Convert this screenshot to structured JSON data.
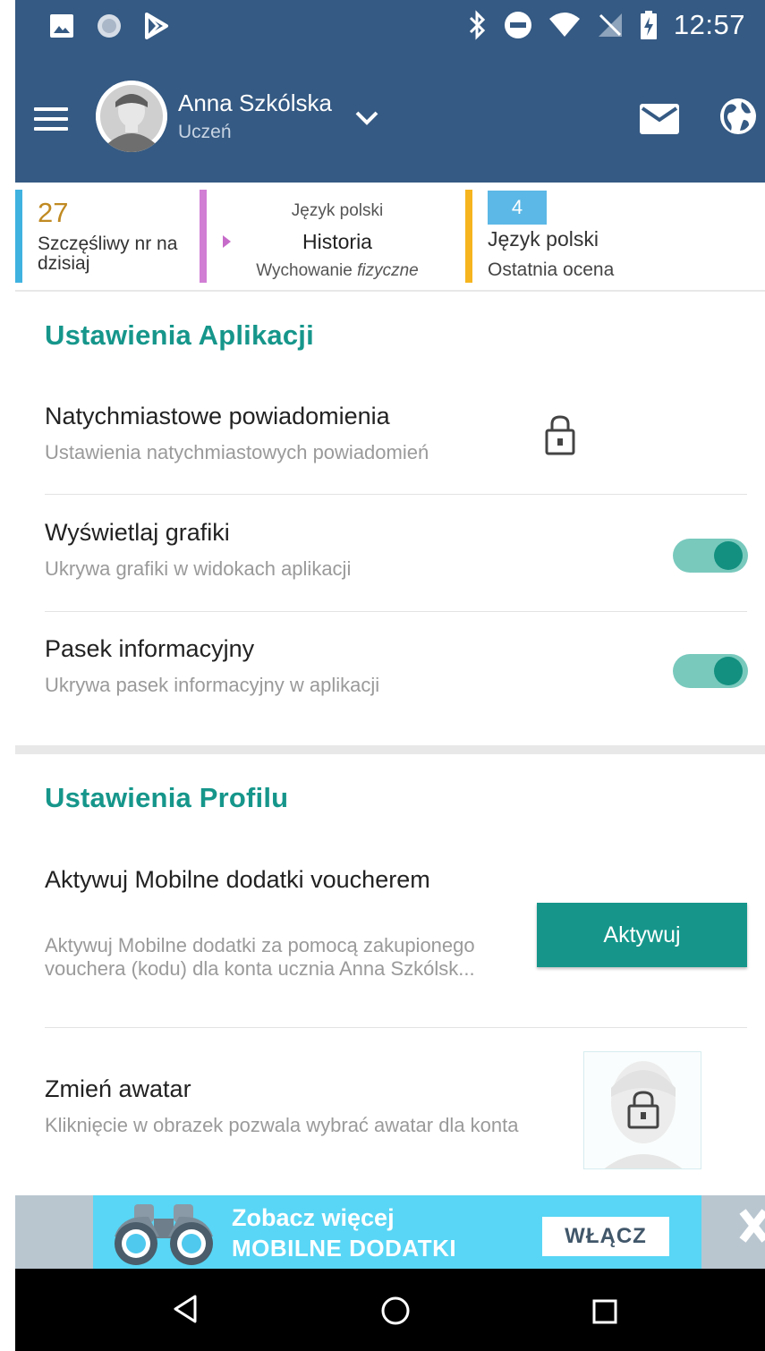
{
  "status_bar": {
    "time": "12:57",
    "left_icons": [
      "image-icon",
      "circle-app-icon",
      "play-store-icon"
    ],
    "right_icons": [
      "bluetooth-icon",
      "do-not-disturb-icon",
      "wifi-icon",
      "no-signal-icon",
      "battery-charging-icon"
    ]
  },
  "header": {
    "user_name": "Anna Szkólska",
    "user_role": "Uczeń",
    "icons": [
      "menu-icon",
      "chevron-down-icon",
      "mail-icon",
      "globe-icon"
    ]
  },
  "info_strip": {
    "lucky_number": "27",
    "lucky_label": "Szczęśliwy nr na dzisiaj",
    "lesson_previous": "Język polski",
    "lesson_current": "Historia",
    "lesson_next_prefix": "Wychowanie ",
    "lesson_next_italic": "fizyczne",
    "last_grade_value": "4",
    "last_grade_subject": "Język polski",
    "last_grade_label": "Ostatnia ocena"
  },
  "app_settings": {
    "title": "Ustawienia Aplikacji",
    "rows": [
      {
        "title": "Natychmiastowe powiadomienia",
        "subtitle": "Ustawienia natychmiastowych powiadomień",
        "control": "lock"
      },
      {
        "title": "Wyświetlaj grafiki",
        "subtitle": "Ukrywa grafiki w widokach aplikacji",
        "control": "toggle",
        "enabled": true
      },
      {
        "title": "Pasek informacyjny",
        "subtitle": "Ukrywa pasek informacyjny w aplikacji",
        "control": "toggle",
        "enabled": true
      }
    ]
  },
  "profile_settings": {
    "title": "Ustawienia Profilu",
    "voucher_title": "Aktywuj Mobilne dodatki voucherem",
    "voucher_subtitle": "Aktywuj Mobilne dodatki za pomocą zakupionego vouchera (kodu) dla konta ucznia Anna Szkólsk...",
    "activate_button": "Aktywuj",
    "avatar_title": "Zmień awatar",
    "avatar_subtitle": "Kliknięcie w obrazek pozwala wybrać awatar dla konta"
  },
  "banner": {
    "line1": "Zobacz więcej",
    "line2": "MOBILNE DODATKI",
    "button": "WŁĄCZ"
  },
  "colors": {
    "header_bg": "#355a83",
    "accent_teal": "#16968b",
    "toggle_track": "#79c9bd",
    "toggle_knob": "#13907f",
    "banner_bg": "#59d6f5"
  }
}
